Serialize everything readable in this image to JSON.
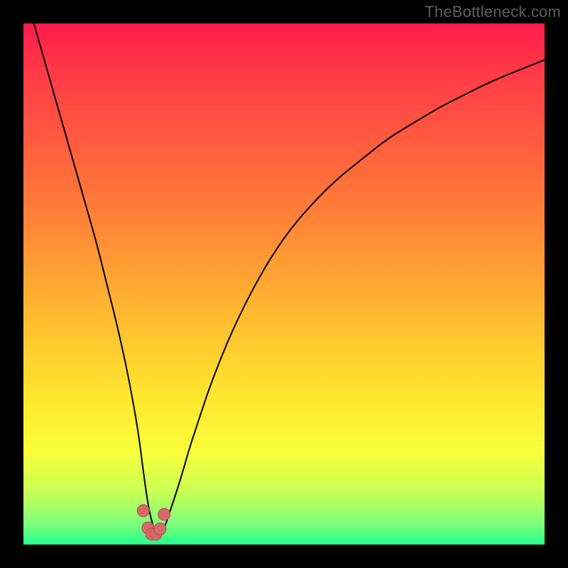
{
  "watermark": "TheBottleneck.com",
  "colors": {
    "frame": "#000000",
    "curve": "#000000",
    "markers_fill": "#d66a6a",
    "markers_stroke": "#b84a4a",
    "gradient_stops": [
      {
        "offset": 0.0,
        "color": "#ff1a4b"
      },
      {
        "offset": 0.1,
        "color": "#ff3c46"
      },
      {
        "offset": 0.22,
        "color": "#ff5a3f"
      },
      {
        "offset": 0.35,
        "color": "#ff7b38"
      },
      {
        "offset": 0.48,
        "color": "#ffa233"
      },
      {
        "offset": 0.6,
        "color": "#ffc62f"
      },
      {
        "offset": 0.72,
        "color": "#ffe72f"
      },
      {
        "offset": 0.82,
        "color": "#fbff3a"
      },
      {
        "offset": 0.9,
        "color": "#c8ff55"
      },
      {
        "offset": 0.96,
        "color": "#7dff7a"
      },
      {
        "offset": 1.0,
        "color": "#22ff8f"
      }
    ]
  },
  "chart_data": {
    "type": "line",
    "title": "",
    "xlabel": "",
    "ylabel": "",
    "xlim": [
      0,
      100
    ],
    "ylim": [
      0,
      100
    ],
    "series": [
      {
        "name": "bottleneck-curve",
        "x": [
          2,
          4,
          6,
          8,
          10,
          12,
          14,
          16,
          18,
          20,
          22,
          23,
          24,
          25,
          26,
          27,
          28,
          30,
          32,
          34,
          36,
          40,
          45,
          50,
          55,
          60,
          65,
          70,
          75,
          80,
          85,
          90,
          95,
          100
        ],
        "y": [
          100,
          93,
          86,
          79,
          72,
          65,
          58,
          50,
          42,
          33,
          22,
          14,
          7,
          3,
          2,
          3,
          6,
          12,
          19,
          25,
          31,
          41,
          51,
          59,
          65,
          70,
          74,
          78,
          81,
          84,
          86.5,
          89,
          91,
          93
        ]
      }
    ],
    "markers": {
      "name": "markers-near-minimum",
      "x": [
        23.0,
        23.9,
        24.6,
        25.4,
        26.2,
        27.0
      ],
      "y": [
        6.5,
        3.2,
        2.0,
        2.0,
        3.0,
        5.8
      ]
    },
    "minimum": {
      "x": 25,
      "y": 2
    }
  }
}
